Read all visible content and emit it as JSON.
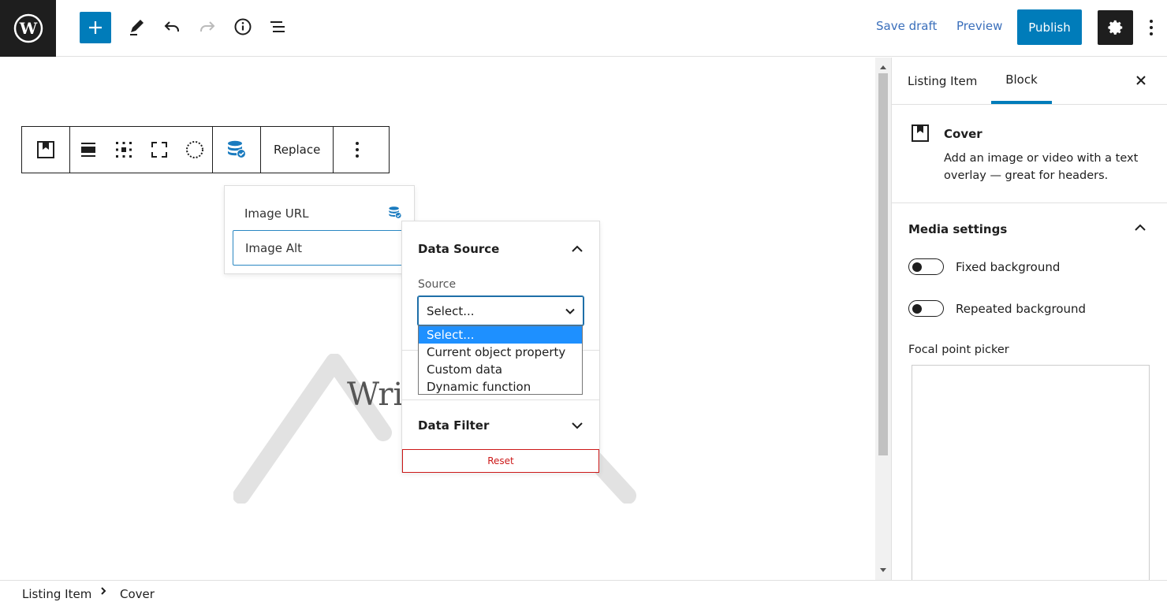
{
  "topbar": {
    "save_draft": "Save draft",
    "preview": "Preview",
    "publish": "Publish",
    "icons": [
      "wordpress-logo",
      "plus-icon",
      "pencil-icon",
      "undo-icon",
      "redo-icon",
      "info-icon",
      "list-view-icon",
      "gear-icon",
      "kebab-icon"
    ]
  },
  "block_toolbar": {
    "replace_label": "Replace",
    "icons": [
      "cover-block-icon",
      "align-icon",
      "position-grid-icon",
      "fullscreen-icon",
      "duotone-icon",
      "dynamic-data-icon",
      "kebab-icon"
    ]
  },
  "attributes": {
    "items": [
      "Image URL",
      "Image Alt"
    ]
  },
  "data_source": {
    "title": "Data Source",
    "source_label": "Source",
    "select_value": "Select...",
    "options": [
      "Select...",
      "Current object property",
      "Custom data",
      "Dynamic function"
    ],
    "filter_title": "Data Filter",
    "reset_label": "Reset"
  },
  "canvas": {
    "placeholder_text": "Wri"
  },
  "sidebar": {
    "tabs": [
      "Listing Item",
      "Block"
    ],
    "active_tab": "Block",
    "block_title": "Cover",
    "block_desc": "Add an image or video with a text overlay — great for headers.",
    "media_settings": "Media settings",
    "fixed_bg": "Fixed background",
    "repeated_bg": "Repeated background",
    "focal_label": "Focal point picker"
  },
  "breadcrumb": [
    "Listing Item",
    "Cover"
  ],
  "colors": {
    "accent": "#007cba",
    "danger": "#cc1818",
    "selected_option": "#1e90ff"
  }
}
